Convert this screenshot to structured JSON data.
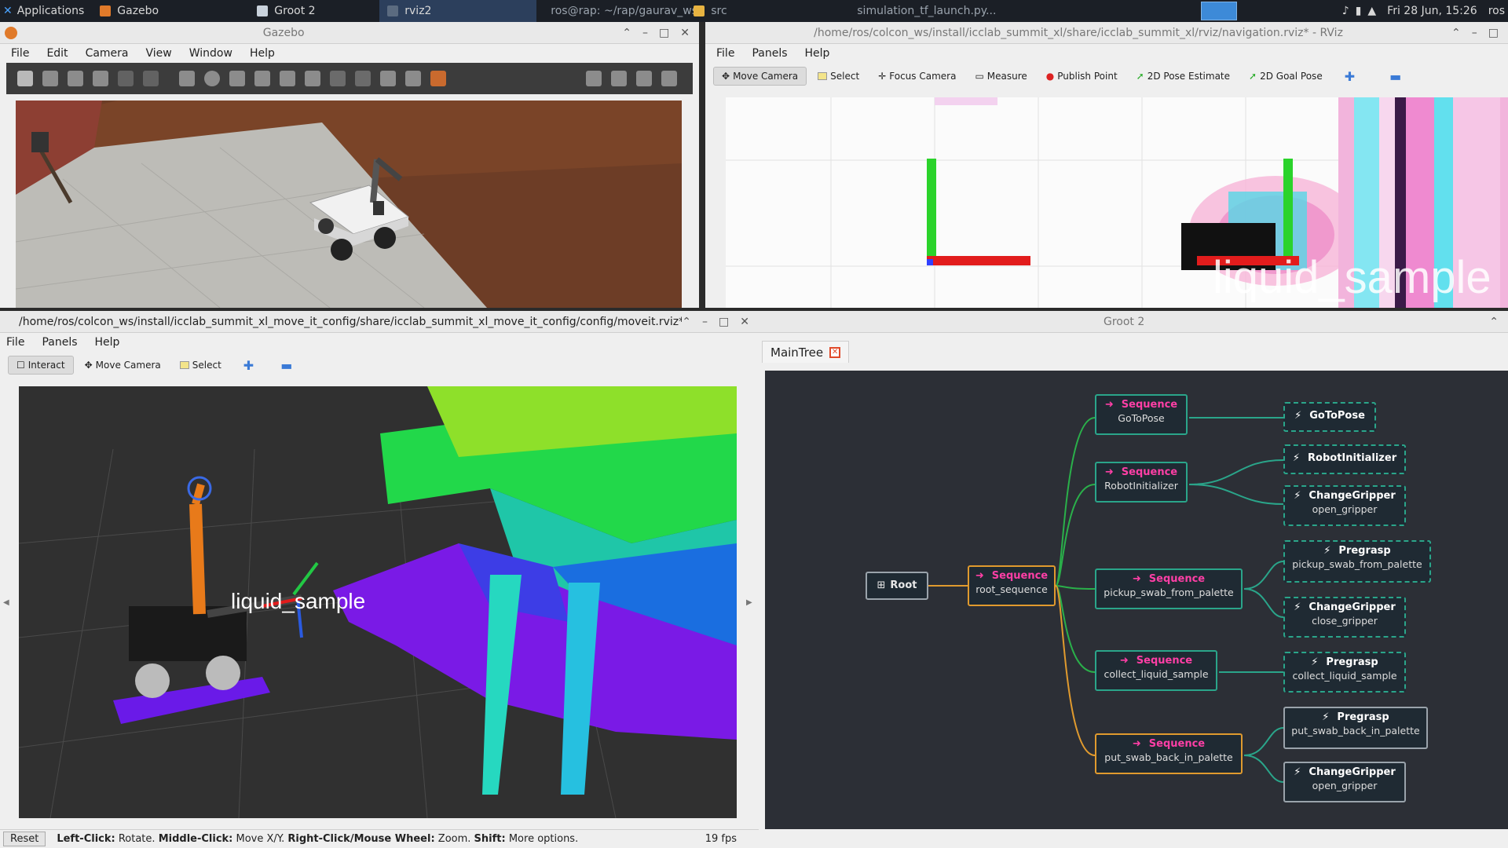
{
  "taskbar": {
    "applications": "Applications",
    "items": [
      {
        "label": "Gazebo"
      },
      {
        "label": "Groot 2"
      },
      {
        "label": "rviz2"
      },
      {
        "label": "ros@rap: ~/rap/gaurav_ws"
      },
      {
        "label": "src"
      },
      {
        "label": "simulation_tf_launch.py..."
      }
    ],
    "datetime": "Fri 28 Jun, 15:26",
    "user": "ros"
  },
  "gazebo": {
    "title": "Gazebo",
    "menu": [
      "File",
      "Edit",
      "Camera",
      "View",
      "Window",
      "Help"
    ]
  },
  "rviz_nav": {
    "title": "/home/ros/colcon_ws/install/icclab_summit_xl/share/icclab_summit_xl/rviz/navigation.rviz* - RViz",
    "menu": [
      "File",
      "Panels",
      "Help"
    ],
    "tools": [
      "Move Camera",
      "Select",
      "Focus Camera",
      "Measure",
      "Publish Point",
      "2D Pose Estimate",
      "2D Goal Pose"
    ],
    "overlay_label": "liquid_sample"
  },
  "rviz_moveit": {
    "title": "/home/ros/colcon_ws/install/icclab_summit_xl_move_it_config/share/icclab_summit_xl_move_it_config/config/moveit.rviz* - RV",
    "menu": [
      "File",
      "Panels",
      "Help"
    ],
    "tools": [
      "Interact",
      "Move Camera",
      "Select"
    ],
    "overlay_label": "liquid_sample",
    "status": {
      "reset": "Reset",
      "left_click": "Left-Click:",
      "left_click_desc": "Rotate.",
      "middle_click": "Middle-Click:",
      "middle_click_desc": "Move X/Y.",
      "right_click": "Right-Click/Mouse Wheel:",
      "right_click_desc": "Zoom.",
      "shift": "Shift:",
      "shift_desc": "More options.",
      "fps": "19 fps"
    }
  },
  "groot": {
    "title": "Groot 2",
    "tab": "MainTree",
    "root": "Root",
    "nodes": [
      {
        "type": "Sequence",
        "name": "root_sequence"
      },
      {
        "type": "Sequence",
        "name": "GoToPose"
      },
      {
        "type": "Sequence",
        "name": "RobotInitializer"
      },
      {
        "type": "Sequence",
        "name": "pickup_swab_from_palette"
      },
      {
        "type": "Sequence",
        "name": "collect_liquid_sample"
      },
      {
        "type": "Sequence",
        "name": "put_swab_back_in_palette"
      }
    ],
    "actions": [
      {
        "type": "GoToPose",
        "name": ""
      },
      {
        "type": "RobotInitializer",
        "name": ""
      },
      {
        "type": "ChangeGripper",
        "name": "open_gripper"
      },
      {
        "type": "Pregrasp",
        "name": "pickup_swab_from_palette"
      },
      {
        "type": "ChangeGripper",
        "name": "close_gripper"
      },
      {
        "type": "Pregrasp",
        "name": "collect_liquid_sample"
      },
      {
        "type": "Pregrasp",
        "name": "put_swab_back_in_palette"
      },
      {
        "type": "ChangeGripper",
        "name": "open_gripper"
      }
    ]
  }
}
